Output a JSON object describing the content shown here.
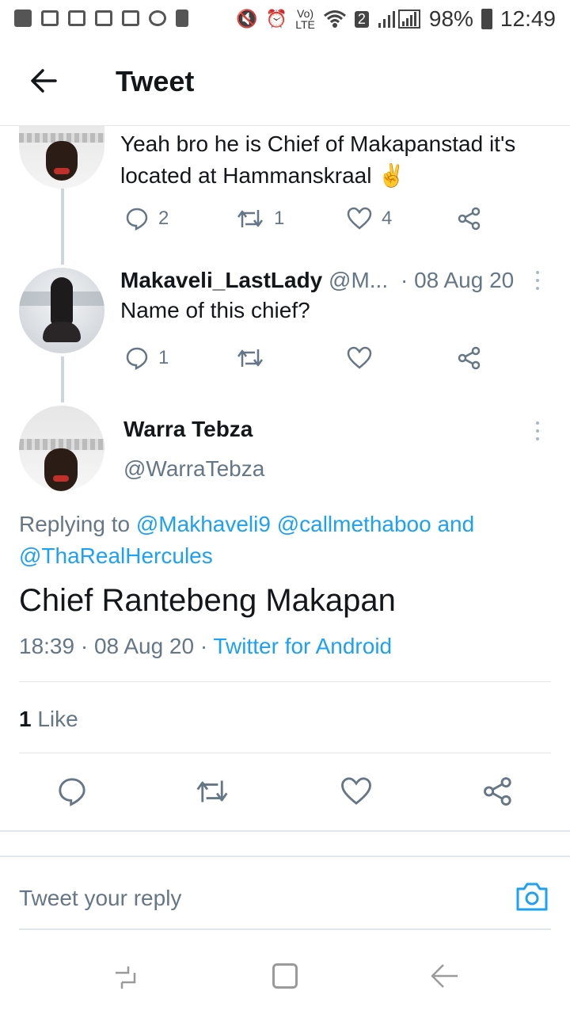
{
  "status_bar": {
    "battery": "98%",
    "time": "12:49",
    "sim": "2"
  },
  "header": {
    "title": "Tweet"
  },
  "tweets": [
    {
      "text": "Yeah bro he is Chief of Makapanstad it's located at Hammanskraal",
      "emoji": "✌",
      "reply_count": "2",
      "retweet_count": "1",
      "like_count": "4"
    },
    {
      "display_name": "Makaveli_LastLady",
      "handle": "@M...",
      "date": "· 08 Aug 20",
      "text": "Name of this chief?",
      "reply_count": "1"
    }
  ],
  "main_tweet": {
    "display_name": "Warra Tebza",
    "handle": "@WarraTebza",
    "replying_prefix": "Replying to",
    "replying_to": "@Makhaveli9 @callmethaboo and @ThaRealHercules",
    "text": "Chief Rantebeng Makapan",
    "time": "18:39 · 08 Aug 20 ·",
    "source": "Twitter for Android",
    "likes_count": "1",
    "likes_label": "Like"
  },
  "reply_bar": {
    "placeholder": "Tweet your reply"
  },
  "colors": {
    "accent": "#1da1f2",
    "muted": "#657786"
  }
}
